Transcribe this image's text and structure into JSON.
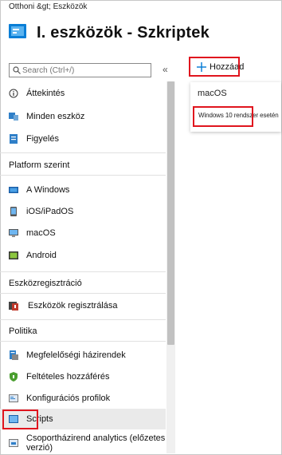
{
  "breadcrumb": {
    "home": "Otthoni &gt;",
    "current": "Eszközök"
  },
  "page_title": "I. eszközök - Szkriptek",
  "search": {
    "placeholder": "Search (Ctrl+/)"
  },
  "collapse_glyph": "«",
  "add_button": {
    "label": "Hozzáad"
  },
  "dropdown": {
    "items": [
      "macOS",
      "Windows 10 rendszer esetén"
    ]
  },
  "nav": {
    "top": [
      "Áttekintés",
      "Minden eszköz",
      "Figyelés"
    ],
    "platform_header": "Platform szerint",
    "platform": [
      "A Windows",
      "iOS/iPadOS",
      "macOS",
      "Android"
    ],
    "enroll_header": "Eszközregisztráció",
    "enroll": [
      "Eszközök regisztrálása"
    ],
    "policy_header": "Politika",
    "policy": [
      "Megfelelőségi házirendek",
      "Feltételes hozzáférés",
      "Konfigurációs profilok",
      "Scripts",
      "Csoportházirend analytics (előzetes verzió)"
    ]
  },
  "colors": {
    "accent": "#0078d4",
    "highlight": "#e0151e",
    "selected_bg": "#eaeaea"
  }
}
